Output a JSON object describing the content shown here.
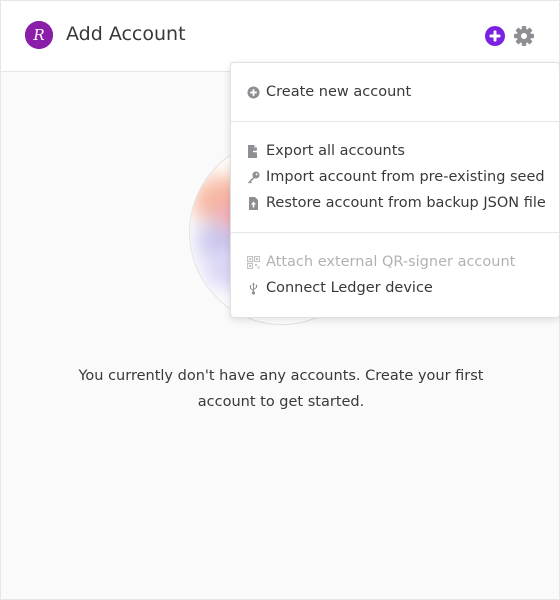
{
  "header": {
    "title": "Add Account",
    "logo_letter": "R",
    "logo_icon": "polkadot-r-logo-icon",
    "add_icon": "plus-circle-icon",
    "settings_icon": "gear-icon"
  },
  "empty_state": {
    "message": "You currently don't have any accounts. Create your first account to get started."
  },
  "menu": {
    "items": [
      {
        "label": "Create new account",
        "icon": "plus-circle-icon",
        "enabled": true
      },
      {
        "label": "Export all accounts",
        "icon": "file-export-icon",
        "enabled": true
      },
      {
        "label": "Import account from pre-existing seed",
        "icon": "key-icon",
        "enabled": true
      },
      {
        "label": "Restore account from backup JSON file",
        "icon": "file-upload-icon",
        "enabled": true
      },
      {
        "label": "Attach external QR-signer account",
        "icon": "qrcode-icon",
        "enabled": false
      },
      {
        "label": "Connect Ledger device",
        "icon": "usb-icon",
        "enabled": true
      }
    ]
  },
  "colors": {
    "accent": "#7b22e0",
    "logo": "#8a1ea8",
    "text": "#393939",
    "icon_gray": "#8e8e93",
    "disabled": "#b2b2b2"
  }
}
